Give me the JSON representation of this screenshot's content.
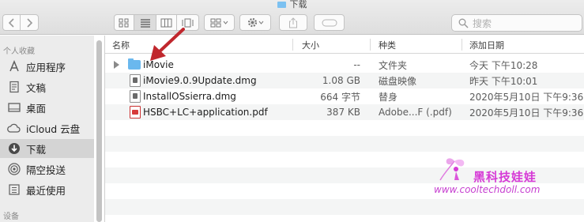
{
  "window": {
    "title": "下载"
  },
  "toolbar": {
    "search_placeholder": "搜索"
  },
  "sidebar": {
    "sections": [
      {
        "header": "个人收藏"
      },
      {
        "header": "设备"
      }
    ],
    "items": [
      {
        "label": "应用程序",
        "icon": "applications-icon"
      },
      {
        "label": "文稿",
        "icon": "documents-icon"
      },
      {
        "label": "桌面",
        "icon": "desktop-icon"
      },
      {
        "label": "iCloud 云盘",
        "icon": "icloud-icon"
      },
      {
        "label": "下载",
        "icon": "downloads-icon",
        "selected": true
      },
      {
        "label": "隔空投送",
        "icon": "airdrop-icon"
      },
      {
        "label": "最近使用",
        "icon": "recents-icon"
      }
    ]
  },
  "columns": {
    "name": "名称",
    "size": "大小",
    "kind": "种类",
    "date": "添加日期"
  },
  "files": [
    {
      "name": "iMovie",
      "size": "--",
      "kind": "文件夹",
      "date": "今天 下午10:28",
      "type": "folder"
    },
    {
      "name": "iMovie9.0.9Update.dmg",
      "size": "1.08 GB",
      "kind": "磁盘映像",
      "date": "昨天 下午10:01",
      "type": "dmg"
    },
    {
      "name": "InstallOSsierra.dmg",
      "size": "664 字节",
      "kind": "替身",
      "date": "2020年5月10日 下午9:36",
      "type": "alias"
    },
    {
      "name": "HSBC+LC+application.pdf",
      "size": "387 KB",
      "kind": "Adobe...F (.pdf)",
      "date": "2020年5月10日 下午9:36",
      "type": "pdf"
    }
  ],
  "watermark": {
    "title": "黑科技娃娃",
    "url": "www.cooltechdoll.com"
  },
  "colors": {
    "selection": "#d4d4d4",
    "folder": "#6ab8ee",
    "annotation_arrow": "#c0272d",
    "watermark": "#d63ad6"
  }
}
